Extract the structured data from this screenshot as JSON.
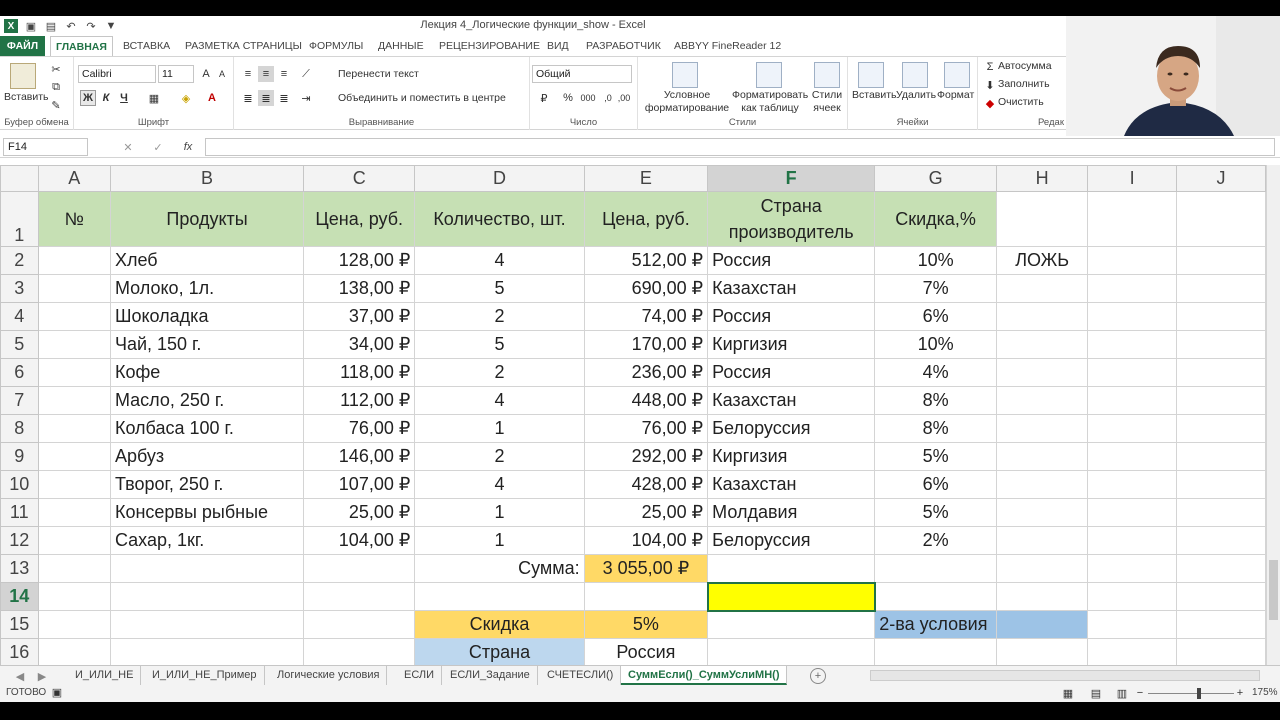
{
  "window": {
    "title": "Лекция 4_Логические функции_show - Excel"
  },
  "ribbon_tabs": [
    "ФАЙЛ",
    "ГЛАВНАЯ",
    "ВСТАВКА",
    "РАЗМЕТКА СТРАНИЦЫ",
    "ФОРМУЛЫ",
    "ДАННЫЕ",
    "РЕЦЕНЗИРОВАНИЕ",
    "ВИД",
    "РАЗРАБОТЧИК",
    "ABBYY FineReader 12"
  ],
  "ribbon": {
    "paste_label": "Вставить",
    "clipboard_group": "Буфер обмена",
    "font_name": "Calibri",
    "font_size": "11",
    "font_group": "Шрифт",
    "bold": "Ж",
    "italic": "К",
    "underline": "Ч",
    "wrap_text": "Перенести текст",
    "merge_center": "Объединить и поместить в центре",
    "alignment_group": "Выравнивание",
    "number_format": "Общий",
    "number_group": "Число",
    "cond_format": "Условное форматирование",
    "format_table": "Форматировать как таблицу",
    "cell_styles": "Стили ячеек",
    "styles_group": "Стили",
    "insert": "Вставить",
    "delete": "Удалить",
    "format": "Формат",
    "cells_group": "Ячейки",
    "autosum": "Автосумма",
    "fill": "Заполнить",
    "clear": "Очистить",
    "editing_group": "Редак"
  },
  "formula_bar": {
    "name_box": "F14",
    "formula": ""
  },
  "columns": [
    "A",
    "B",
    "C",
    "D",
    "E",
    "F",
    "G",
    "H",
    "I",
    "J"
  ],
  "rows": {
    "r1": {
      "num": "1",
      "a": "№",
      "b": "Продукты",
      "c": "Цена, руб.",
      "d": "Количество, шт.",
      "e": "Цена, руб.",
      "f1": "Страна",
      "f2": "производитель",
      "g": "Скидка,%"
    },
    "r2": {
      "num": "2",
      "b": "Хлеб",
      "c": "128,00 ₽",
      "d": "4",
      "e": "512,00 ₽",
      "f": "Россия",
      "g": "10%",
      "h": "ЛОЖЬ"
    },
    "r3": {
      "num": "3",
      "b": "Молоко, 1л.",
      "c": "138,00 ₽",
      "d": "5",
      "e": "690,00 ₽",
      "f": "Казахстан",
      "g": "7%"
    },
    "r4": {
      "num": "4",
      "b": "Шоколадка",
      "c": "37,00 ₽",
      "d": "2",
      "e": "74,00 ₽",
      "f": "Россия",
      "g": "6%"
    },
    "r5": {
      "num": "5",
      "b": "Чай, 150 г.",
      "c": "34,00 ₽",
      "d": "5",
      "e": "170,00 ₽",
      "f": "Киргизия",
      "g": "10%"
    },
    "r6": {
      "num": "6",
      "b": "Кофе",
      "c": "118,00 ₽",
      "d": "2",
      "e": "236,00 ₽",
      "f": "Россия",
      "g": "4%"
    },
    "r7": {
      "num": "7",
      "b": "Масло, 250 г.",
      "c": "112,00 ₽",
      "d": "4",
      "e": "448,00 ₽",
      "f": "Казахстан",
      "g": "8%"
    },
    "r8": {
      "num": "8",
      "b": "Колбаса 100 г.",
      "c": "76,00 ₽",
      "d": "1",
      "e": "76,00 ₽",
      "f": "Белоруссия",
      "g": "8%"
    },
    "r9": {
      "num": "9",
      "b": "Арбуз",
      "c": "146,00 ₽",
      "d": "2",
      "e": "292,00 ₽",
      "f": "Киргизия",
      "g": "5%"
    },
    "r10": {
      "num": "10",
      "b": "Творог, 250 г.",
      "c": "107,00 ₽",
      "d": "4",
      "e": "428,00 ₽",
      "f": "Казахстан",
      "g": "6%"
    },
    "r11": {
      "num": "11",
      "b": "Консервы рыбные",
      "c": "25,00 ₽",
      "d": "1",
      "e": "25,00 ₽",
      "f": "Молдавия",
      "g": "5%"
    },
    "r12": {
      "num": "12",
      "b": "Сахар, 1кг.",
      "c": "104,00 ₽",
      "d": "1",
      "e": "104,00 ₽",
      "f": "Белоруссия",
      "g": "2%"
    },
    "r13": {
      "num": "13",
      "d": "Сумма:",
      "e": "3 055,00 ₽"
    },
    "r14": {
      "num": "14"
    },
    "r15": {
      "num": "15",
      "d": "Скидка",
      "e": "5%",
      "g": "2-ва условия"
    },
    "r16": {
      "num": "16",
      "d": "Страна",
      "e": "Россия"
    }
  },
  "sheet_tabs": [
    "И_ИЛИ_НЕ",
    "И_ИЛИ_НЕ_Пример",
    "Логические условия",
    "ЕСЛИ",
    "ЕСЛИ_Задание",
    "СЧЕТЕСЛИ()",
    "СуммЕсли()_СуммУслиМН()"
  ],
  "status": {
    "ready": "ГОТОВО",
    "zoom": "175%"
  },
  "colors": {
    "excel_green": "#217346",
    "header_green": "#c6e0b4",
    "orange": "#ffd966",
    "blue": "#9dc3e6",
    "yellow": "#ffff00"
  }
}
